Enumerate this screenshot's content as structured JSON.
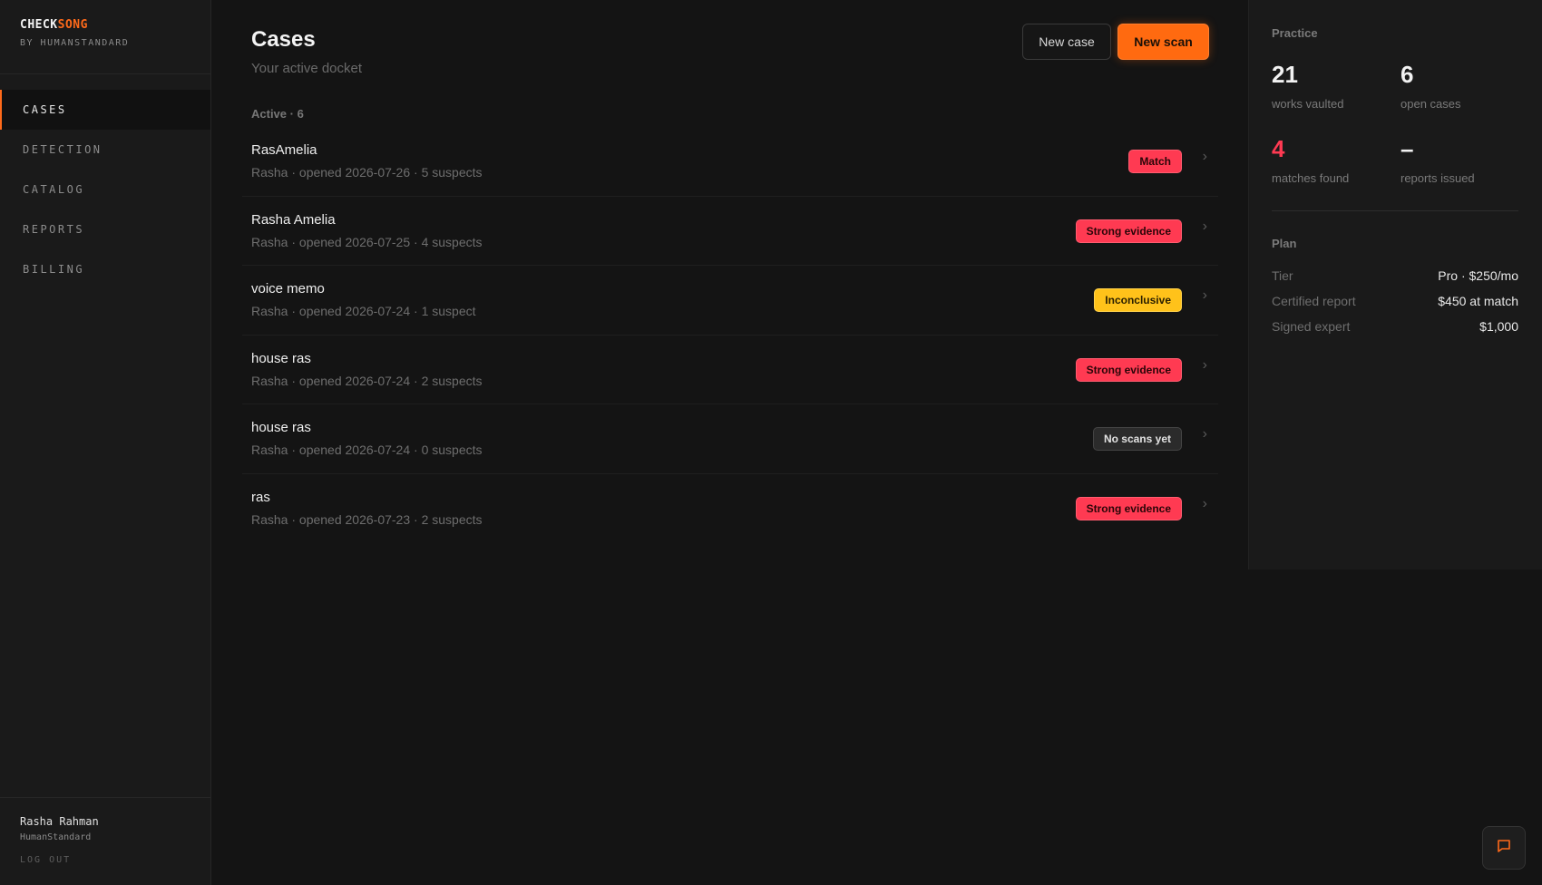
{
  "brand": {
    "name_part1": "CHECK",
    "name_part2": "SONG",
    "sub": "BY HUMANSTANDARD",
    "accent_color": "#ff6a1a"
  },
  "sidebar": {
    "items": [
      {
        "label": "CASES",
        "active": true
      },
      {
        "label": "DETECTION",
        "active": false
      },
      {
        "label": "CATALOG",
        "active": false
      },
      {
        "label": "REPORTS",
        "active": false
      },
      {
        "label": "BILLING",
        "active": false
      }
    ]
  },
  "user": {
    "name": "Rasha Rahman",
    "org": "HumanStandard",
    "logout": "LOG OUT"
  },
  "main": {
    "title": "Cases",
    "subtitle": "Your active docket",
    "new_case_label": "New case",
    "new_scan_label": "New scan",
    "section_label": "Active · 6",
    "cases": [
      {
        "title": "RasAmelia",
        "meta": "Rasha · opened 2026-07-26 · 5 suspects",
        "status": "Match",
        "status_color": "red"
      },
      {
        "title": "Rasha Amelia",
        "meta": "Rasha · opened 2026-07-25 · 4 suspects",
        "status": "Strong evidence",
        "status_color": "red"
      },
      {
        "title": "voice memo",
        "meta": "Rasha · opened 2026-07-24 · 1 suspect",
        "status": "Inconclusive",
        "status_color": "yellow"
      },
      {
        "title": "house ras",
        "meta": "Rasha · opened 2026-07-24 · 2 suspects",
        "status": "Strong evidence",
        "status_color": "red"
      },
      {
        "title": "house ras",
        "meta": "Rasha · opened 2026-07-24 · 0 suspects",
        "status": "No scans yet",
        "status_color": "gray"
      },
      {
        "title": "ras",
        "meta": "Rasha · opened 2026-07-23 · 2 suspects",
        "status": "Strong evidence",
        "status_color": "red"
      }
    ]
  },
  "practice": {
    "label": "Practice",
    "stats": [
      {
        "value": "21",
        "label": "works vaulted"
      },
      {
        "value": "6",
        "label": "open cases"
      },
      {
        "value": "4",
        "label": "matches found"
      },
      {
        "value": "–",
        "label": "reports issued"
      }
    ]
  },
  "plan": {
    "label": "Plan",
    "rows": [
      {
        "key": "Tier",
        "value": "Pro · $250/mo"
      },
      {
        "key": "Certified report",
        "value": "$450 at match"
      },
      {
        "key": "Signed expert",
        "value": "$1,000"
      }
    ]
  },
  "chat": {
    "icon": "chat-icon"
  }
}
